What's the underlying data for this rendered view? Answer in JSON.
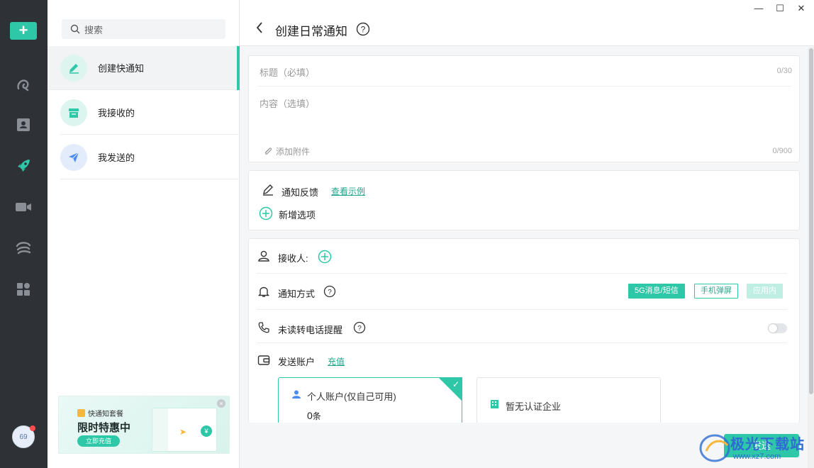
{
  "rail": {
    "add_label": "+",
    "avatar_label": "69"
  },
  "nav": {
    "search_placeholder": "搜索",
    "items": [
      {
        "label": "创建快通知",
        "icon": "pen-icon"
      },
      {
        "label": "我接收的",
        "icon": "inbox-icon"
      },
      {
        "label": "我发送的",
        "icon": "paper-plane-icon"
      }
    ],
    "promo": {
      "tag": "快通知套餐",
      "headline": "限时特惠中",
      "button": "立即充值",
      "coin": "¥"
    }
  },
  "header": {
    "title": "创建日常通知"
  },
  "form": {
    "title_placeholder": "标题（必填）",
    "title_counter": "0/30",
    "content_placeholder": "内容（选填）",
    "content_counter": "0/900",
    "attach_label": "添加附件",
    "feedback_label": "通知反馈",
    "feedback_link": "查看示例",
    "add_option_label": "新增选项",
    "recipient_label": "接收人:",
    "method_label": "通知方式",
    "methods": [
      "5G消息/短信",
      "手机弹屏",
      "应用内"
    ],
    "phone_remind_label": "未读转电话提醒",
    "account_label": "发送账户",
    "recharge_link": "充值",
    "personal_account": "个人账户(仅自己可用)",
    "personal_count": "0",
    "personal_unit": "条",
    "enterprise_label": "暂无认证企业"
  },
  "send_label": "发送",
  "watermark": {
    "text": "极光下载站",
    "url": "www.xz7.com"
  },
  "colors": {
    "accent": "#2ec7a8",
    "rail": "#2e3135"
  }
}
